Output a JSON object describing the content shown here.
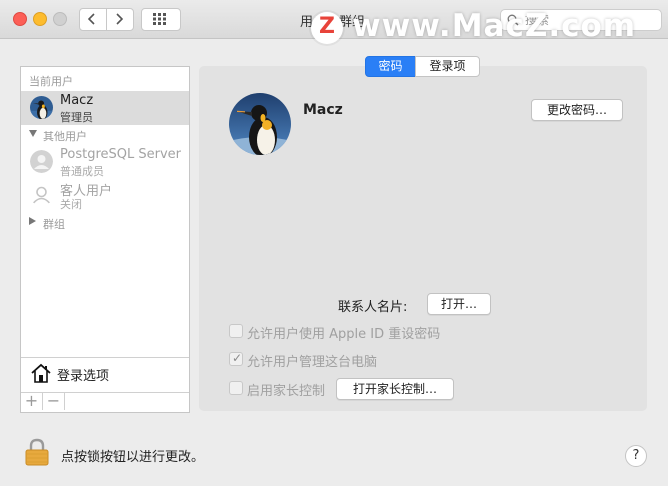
{
  "window": {
    "title": "用户与群组",
    "search_placeholder": "搜索"
  },
  "watermark": {
    "logo_letter": "Z",
    "text": "www.MacZ.com"
  },
  "sidebar": {
    "current_users_heading": "当前用户",
    "current_user": {
      "name": "Macz",
      "role": "管理员"
    },
    "other_users_heading": "其他用户",
    "other_users": [
      {
        "name": "PostgreSQL Server",
        "role": "普通成员"
      },
      {
        "name": "客人用户",
        "role": "关闭"
      }
    ],
    "groups_heading": "群组",
    "login_options_label": "登录选项",
    "add_symbol": "+",
    "remove_symbol": "−"
  },
  "tabs": [
    {
      "label": "密码",
      "active": true
    },
    {
      "label": "登录项",
      "active": false
    }
  ],
  "user_panel": {
    "username": "Macz",
    "change_password_label": "更改密码…",
    "contact_card_label": "联系人名片:",
    "open_label": "打开…",
    "checkboxes": [
      {
        "label": "允许用户使用 Apple ID 重设密码",
        "checked": false
      },
      {
        "label": "允许用户管理这台电脑",
        "checked": true
      },
      {
        "label": "启用家长控制",
        "checked": false
      }
    ],
    "open_parental_label": "打开家长控制…"
  },
  "footer": {
    "lock_text": "点按锁按钮以进行更改。",
    "help_label": "?"
  },
  "colors": {
    "accent": "#2a7ff6",
    "panel_bg": "#e2e2e2",
    "window_bg": "#ececec"
  }
}
